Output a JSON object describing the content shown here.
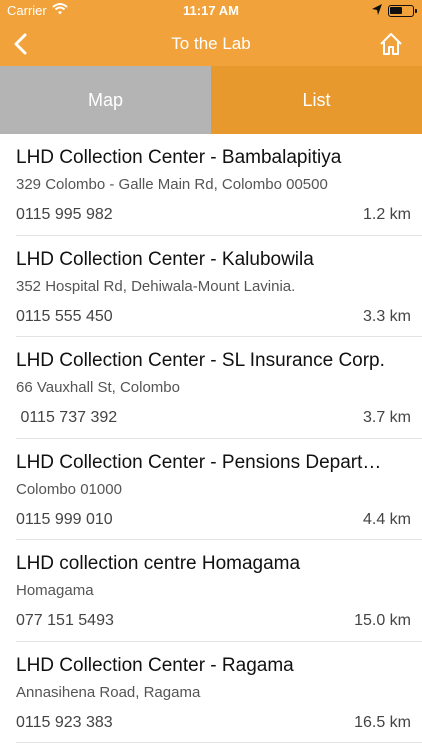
{
  "status_bar": {
    "carrier": "Carrier",
    "time": "11:17 AM",
    "icons": [
      "wifi-icon",
      "location-arrow-icon",
      "battery-icon"
    ]
  },
  "nav": {
    "title": "To the Lab",
    "back_icon": "chevron-left-icon",
    "home_icon": "home-icon"
  },
  "tabs": [
    {
      "label": "Map",
      "selected": false
    },
    {
      "label": "List",
      "selected": true
    }
  ],
  "colors": {
    "accent": "#f2a23a",
    "tab_selected": "#e8992e",
    "tab_unselected": "#b4b4b4"
  },
  "labs": [
    {
      "name": "LHD Collection Center - Bambalapitiya",
      "address": "329 Colombo - Galle Main Rd, Colombo 00500",
      "phone": "0115 995 982",
      "distance": "1.2 km"
    },
    {
      "name": "LHD Collection Center - Kalubowila",
      "address": "352 Hospital Rd, Dehiwala-Mount Lavinia.",
      "phone": "0115 555 450",
      "distance": "3.3 km"
    },
    {
      "name": "LHD Collection Center - SL Insurance Corp.",
      "address": "66 Vauxhall St, Colombo",
      "phone": " 0115 737 392",
      "distance": "3.7 km"
    },
    {
      "name": "LHD Collection Center - Pensions Depart…",
      "address": "Colombo 01000",
      "phone": "0115 999 010",
      "distance": "4.4 km"
    },
    {
      "name": "LHD collection centre Homagama",
      "address": "Homagama",
      "phone": "077 151 5493",
      "distance": "15.0 km"
    },
    {
      "name": "LHD Collection Center - Ragama",
      "address": "Annasihena Road, Ragama",
      "phone": "0115 923 383",
      "distance": "16.5 km"
    }
  ]
}
